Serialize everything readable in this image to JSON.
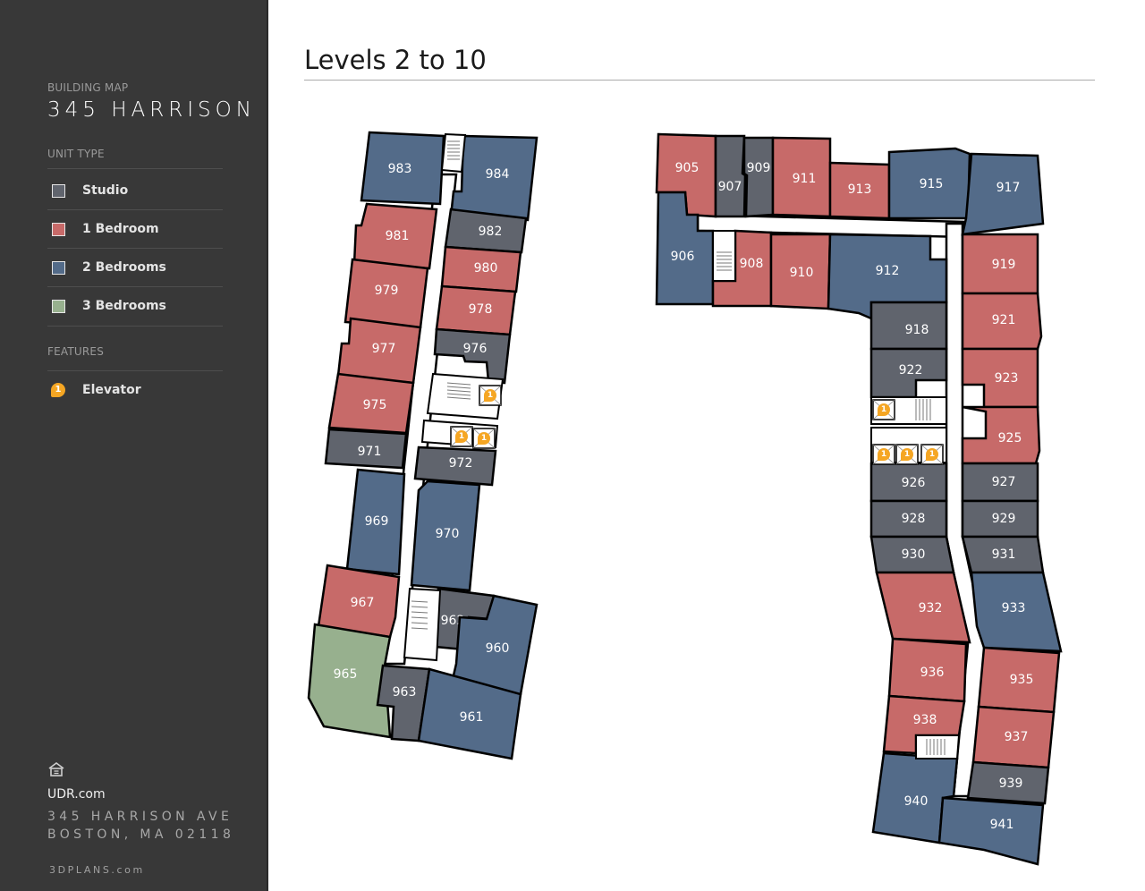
{
  "sidebar": {
    "subtitle": "BUILDING MAP",
    "title": "345 HARRISON",
    "unit_type_heading": "UNIT TYPE",
    "unit_types": [
      {
        "key": "studio",
        "label": "Studio",
        "color": "#60646d"
      },
      {
        "key": "1br",
        "label": "1 Bedroom",
        "color": "#c76a69"
      },
      {
        "key": "2br",
        "label": "2 Bedrooms",
        "color": "#536b89"
      },
      {
        "key": "3br",
        "label": "3 Bedrooms",
        "color": "#97b08e"
      }
    ],
    "features_heading": "FEATURES",
    "features": [
      {
        "icon": "elevator-icon",
        "badge": "1",
        "label": "Elevator",
        "color": "#f5a623"
      }
    ],
    "footer": {
      "icon": "equal-housing-icon",
      "website": "UDR.com",
      "address_line1": "345 HARRISON AVE",
      "address_line2": "BOSTON, MA 02118",
      "credit": "3DPLANS.com"
    }
  },
  "main": {
    "title": "Levels 2 to 10"
  },
  "map": {
    "elevator_badge": "1",
    "units": [
      {
        "id": "983",
        "type": "2br"
      },
      {
        "id": "984",
        "type": "2br"
      },
      {
        "id": "981",
        "type": "1br"
      },
      {
        "id": "982",
        "type": "studio"
      },
      {
        "id": "980",
        "type": "1br"
      },
      {
        "id": "979",
        "type": "1br"
      },
      {
        "id": "978",
        "type": "1br"
      },
      {
        "id": "977",
        "type": "1br"
      },
      {
        "id": "976",
        "type": "studio"
      },
      {
        "id": "975",
        "type": "1br"
      },
      {
        "id": "971",
        "type": "studio"
      },
      {
        "id": "972",
        "type": "studio"
      },
      {
        "id": "969",
        "type": "2br"
      },
      {
        "id": "970",
        "type": "2br"
      },
      {
        "id": "967",
        "type": "1br"
      },
      {
        "id": "962",
        "type": "studio"
      },
      {
        "id": "960",
        "type": "2br"
      },
      {
        "id": "965",
        "type": "3br"
      },
      {
        "id": "963",
        "type": "studio"
      },
      {
        "id": "961",
        "type": "2br"
      },
      {
        "id": "905",
        "type": "1br"
      },
      {
        "id": "907",
        "type": "studio"
      },
      {
        "id": "909",
        "type": "studio"
      },
      {
        "id": "911",
        "type": "1br"
      },
      {
        "id": "913",
        "type": "1br"
      },
      {
        "id": "915",
        "type": "2br"
      },
      {
        "id": "917",
        "type": "2br"
      },
      {
        "id": "906",
        "type": "2br"
      },
      {
        "id": "908",
        "type": "1br"
      },
      {
        "id": "910",
        "type": "1br"
      },
      {
        "id": "912",
        "type": "2br"
      },
      {
        "id": "919",
        "type": "1br"
      },
      {
        "id": "918",
        "type": "studio"
      },
      {
        "id": "921",
        "type": "1br"
      },
      {
        "id": "922",
        "type": "studio"
      },
      {
        "id": "923",
        "type": "1br"
      },
      {
        "id": "925",
        "type": "1br"
      },
      {
        "id": "926",
        "type": "studio"
      },
      {
        "id": "927",
        "type": "studio"
      },
      {
        "id": "928",
        "type": "studio"
      },
      {
        "id": "929",
        "type": "studio"
      },
      {
        "id": "930",
        "type": "studio"
      },
      {
        "id": "931",
        "type": "studio"
      },
      {
        "id": "932",
        "type": "1br"
      },
      {
        "id": "933",
        "type": "2br"
      },
      {
        "id": "936",
        "type": "1br"
      },
      {
        "id": "935",
        "type": "1br"
      },
      {
        "id": "938",
        "type": "1br"
      },
      {
        "id": "937",
        "type": "1br"
      },
      {
        "id": "939",
        "type": "studio"
      },
      {
        "id": "940",
        "type": "2br"
      },
      {
        "id": "941",
        "type": "2br"
      }
    ]
  }
}
